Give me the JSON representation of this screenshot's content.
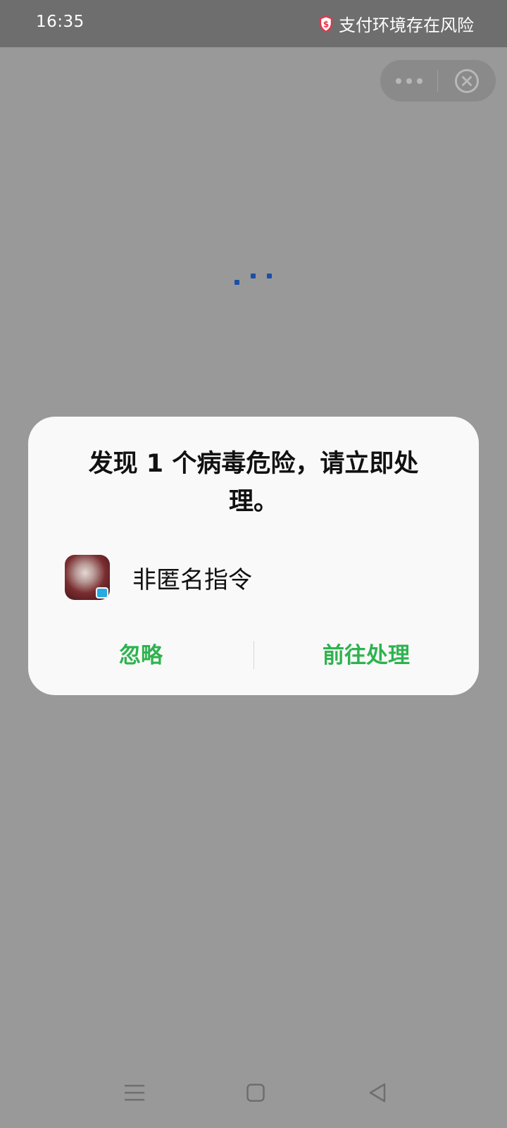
{
  "status_bar": {
    "time": "16:35",
    "alert_text": "支付环境存在风险",
    "alert_icon": "shield-dollar-icon",
    "alert_color": "#e8334a"
  },
  "capsule": {
    "more_icon": "more-dots-icon",
    "close_icon": "close-circle-icon"
  },
  "loading": {
    "icon": "loading-dots-icon",
    "color": "#1c4fa8"
  },
  "dialog": {
    "title_line1": "发现 1 个病毒危险，请立即处",
    "title_line2": "理。",
    "app_name": "非匿名指令",
    "app_icon": "app-icon",
    "ignore_label": "忽略",
    "handle_label": "前往处理",
    "button_color": "#2eb34f"
  },
  "nav_bar": {
    "menu_icon": "menu-icon",
    "home_icon": "home-square-icon",
    "back_icon": "back-triangle-icon"
  }
}
